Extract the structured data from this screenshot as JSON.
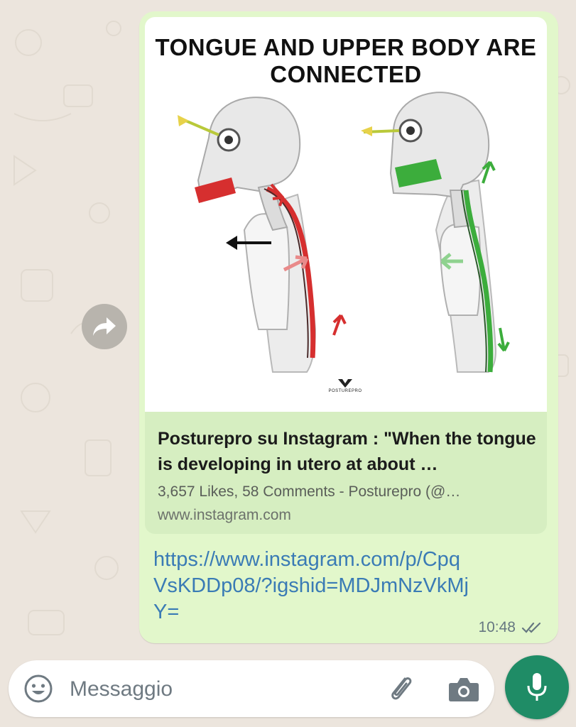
{
  "colors": {
    "chat_background": "#ece5dd",
    "outgoing_bubble": "#e2f7cb",
    "link_preview_background": "#d6eec1",
    "link_color": "#3a7bb5",
    "read_ticks": "#667781",
    "mic_button": "#1f8c66",
    "posture_bad": "#d62f2f",
    "posture_good": "#3cad3c"
  },
  "forward_button": {
    "icon": "forward-arrow-icon"
  },
  "message": {
    "link_preview": {
      "image": {
        "title": "TONGUE AND UPPER BODY ARE\nCONNECTED",
        "brand": "POSTUREPRO",
        "figures": [
          {
            "name": "poor-posture-figure",
            "color": "#d62f2f"
          },
          {
            "name": "good-posture-figure",
            "color": "#3cad3c"
          }
        ]
      },
      "title": "Posturepro su Instagram : \"When the tongue is developing in utero at about …",
      "meta": "3,657 Likes, 58 Comments - Posturepro (@…",
      "domain": "www.instagram.com"
    },
    "url": "https://www.instagram.com/p/CpqVsKDDp08/?igshid=MDJmNzVkMjY=",
    "time": "10:48",
    "status_icon": "double-check-icon"
  },
  "composer": {
    "placeholder": "Messaggio",
    "value": "",
    "icons": {
      "emoji": "emoji-icon",
      "attach": "paperclip-icon",
      "camera": "camera-icon",
      "send": "microphone-icon"
    }
  }
}
